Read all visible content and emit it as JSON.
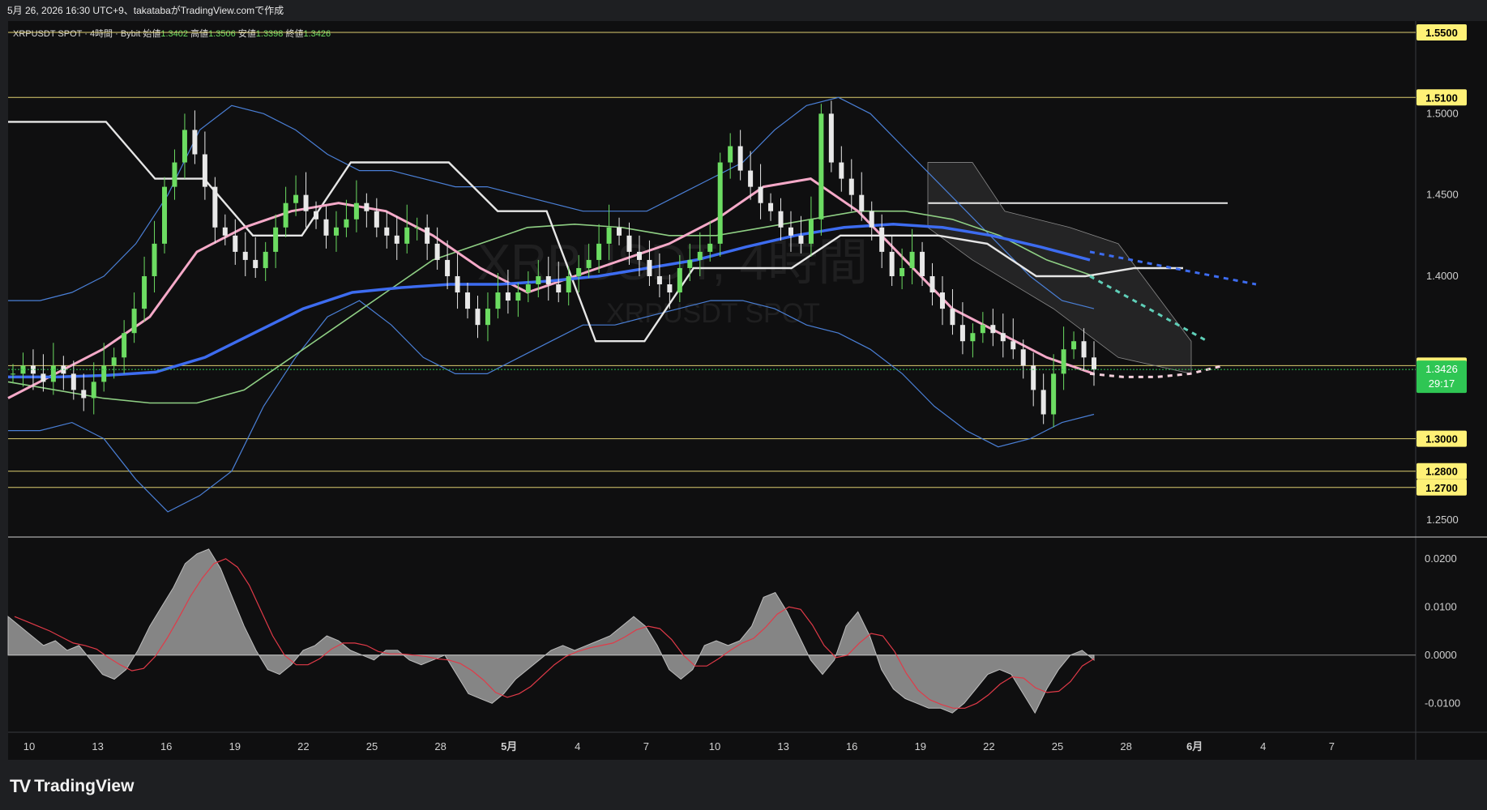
{
  "header": {
    "created_line": "5月 26, 2026 16:30 UTC+9、takatabaがTradingView.comで作成"
  },
  "legend": {
    "symbol_line": "XRPUSDT SPOT · 4時間 · Bybit",
    "open_label": "始値",
    "open_value": "1.3402",
    "high_label": "高値",
    "high_value": "1.3506",
    "low_label": "安値",
    "low_value": "1.3398",
    "close_label": "終値",
    "close_value": "1.3426"
  },
  "watermark": {
    "line1": "XRPUSDT, 4時間",
    "line2": "XRPUSDT SPOT"
  },
  "footer": {
    "brand": "TradingView"
  },
  "countdown": "29:17",
  "colors": {
    "background": "#0f0f10",
    "panel": "#1e1f22",
    "up_candle": "#6cdc62",
    "down_candle": "#e8e8e8",
    "level_line": "#f4e27a",
    "level_label_bg": "#fff176",
    "price_label_bg": "#2fc654",
    "ema_long": "#3d6cf0",
    "ema_mid": "#f5a9c8",
    "sma_green": "#8fcf84",
    "bollinger": "#4a7fd6",
    "ichimoku": "#e6e6e6",
    "oscillator_fill": "#9a9a9a",
    "signal_line": "#e03a48"
  },
  "chart_data": [
    {
      "type": "candlestick",
      "symbol": "XRPUSDT SPOT",
      "timeframe": "4時間",
      "exchange": "Bybit",
      "ylim": [
        1.24,
        1.555
      ],
      "y_ticks": [
        "1.5000",
        "1.4500",
        "1.4000",
        "1.2500"
      ],
      "x_ticks": [
        "10",
        "13",
        "16",
        "19",
        "22",
        "25",
        "28",
        "5月",
        "4",
        "7",
        "10",
        "13",
        "16",
        "19",
        "22",
        "25",
        "28",
        "6月",
        "4",
        "7"
      ],
      "horizontal_levels": [
        "1.5500",
        "1.5100",
        "1.3450",
        "1.3000",
        "1.2800",
        "1.2700"
      ],
      "current_price": "1.3426",
      "ohlc_last": {
        "open": 1.3402,
        "high": 1.3506,
        "low": 1.3398,
        "close": 1.3426
      },
      "series": [
        {
          "kind": "close_path",
          "values": [
            1.34,
            1.345,
            1.34,
            1.335,
            1.345,
            1.34,
            1.33,
            1.325,
            1.335,
            1.345,
            1.35,
            1.365,
            1.38,
            1.4,
            1.42,
            1.455,
            1.47,
            1.49,
            1.475,
            1.455,
            1.43,
            1.425,
            1.415,
            1.41,
            1.405,
            1.415,
            1.43,
            1.445,
            1.45,
            1.44,
            1.435,
            1.425,
            1.43,
            1.435,
            1.445,
            1.44,
            1.43,
            1.425,
            1.42,
            1.43,
            1.43,
            1.42,
            1.41,
            1.4,
            1.39,
            1.38,
            1.37,
            1.38,
            1.39,
            1.385,
            1.39,
            1.395,
            1.4,
            1.395,
            1.39,
            1.4,
            1.405,
            1.41,
            1.42,
            1.43,
            1.425,
            1.415,
            1.41,
            1.4,
            1.395,
            1.39,
            1.405,
            1.41,
            1.415,
            1.42,
            1.47,
            1.48,
            1.465,
            1.455,
            1.445,
            1.44,
            1.43,
            1.425,
            1.42,
            1.435,
            1.5,
            1.47,
            1.46,
            1.45,
            1.44,
            1.43,
            1.415,
            1.4,
            1.405,
            1.415,
            1.4,
            1.39,
            1.38,
            1.37,
            1.36,
            1.365,
            1.37,
            1.365,
            1.36,
            1.355,
            1.345,
            1.33,
            1.315,
            1.34,
            1.355,
            1.36,
            1.35,
            1.3426
          ]
        },
        {
          "kind": "bollinger_upper",
          "values": [
            1.385,
            1.385,
            1.39,
            1.4,
            1.42,
            1.45,
            1.49,
            1.505,
            1.5,
            1.49,
            1.475,
            1.465,
            1.465,
            1.46,
            1.455,
            1.455,
            1.45,
            1.445,
            1.44,
            1.44,
            1.44,
            1.45,
            1.46,
            1.47,
            1.49,
            1.505,
            1.51,
            1.5,
            1.48,
            1.46,
            1.44,
            1.42,
            1.4,
            1.385,
            1.38
          ]
        },
        {
          "kind": "bollinger_lower",
          "values": [
            1.305,
            1.305,
            1.31,
            1.3,
            1.275,
            1.255,
            1.265,
            1.28,
            1.32,
            1.35,
            1.375,
            1.385,
            1.37,
            1.35,
            1.34,
            1.34,
            1.35,
            1.36,
            1.37,
            1.37,
            1.375,
            1.38,
            1.385,
            1.385,
            1.38,
            1.37,
            1.365,
            1.355,
            1.34,
            1.32,
            1.305,
            1.295,
            1.3,
            1.31,
            1.315
          ]
        },
        {
          "kind": "ema_long",
          "values": [
            1.338,
            1.338,
            1.339,
            1.341,
            1.35,
            1.365,
            1.38,
            1.39,
            1.393,
            1.395,
            1.395,
            1.397,
            1.4,
            1.405,
            1.41,
            1.418,
            1.425,
            1.43,
            1.432,
            1.43,
            1.425,
            1.418,
            1.41
          ]
        },
        {
          "kind": "ema_mid",
          "values": [
            1.325,
            1.34,
            1.355,
            1.375,
            1.415,
            1.43,
            1.44,
            1.445,
            1.44,
            1.425,
            1.405,
            1.39,
            1.4,
            1.41,
            1.42,
            1.435,
            1.455,
            1.46,
            1.44,
            1.41,
            1.38,
            1.365,
            1.35,
            1.34
          ]
        },
        {
          "kind": "sma_green",
          "values": [
            1.335,
            1.33,
            1.325,
            1.322,
            1.322,
            1.33,
            1.35,
            1.37,
            1.39,
            1.41,
            1.42,
            1.43,
            1.432,
            1.43,
            1.425,
            1.425,
            1.43,
            1.435,
            1.44,
            1.44,
            1.435,
            1.425,
            1.41,
            1.4
          ]
        },
        {
          "kind": "ichimoku_base",
          "values": [
            1.495,
            1.495,
            1.495,
            1.46,
            1.46,
            1.425,
            1.425,
            1.47,
            1.47,
            1.47,
            1.44,
            1.44,
            1.36,
            1.36,
            1.405,
            1.405,
            1.405,
            1.425,
            1.425,
            1.425,
            1.42,
            1.4,
            1.4,
            1.405,
            1.405
          ]
        },
        {
          "kind": "ichimoku_senkou_top",
          "values": [
            1.445,
            1.445,
            1.445,
            1.445,
            1.445
          ]
        },
        {
          "kind": "projection_blue",
          "values": [
            1.415,
            1.41,
            1.405,
            1.4,
            1.395
          ]
        },
        {
          "kind": "projection_teal",
          "values": [
            1.4,
            1.39,
            1.38,
            1.37,
            1.36
          ]
        },
        {
          "kind": "projection_pink",
          "values": [
            1.34,
            1.338,
            1.338,
            1.34,
            1.345
          ]
        }
      ]
    },
    {
      "type": "area",
      "name": "oscillator",
      "ylim": [
        -0.016,
        0.024
      ],
      "y_ticks": [
        "0.0200",
        "0.0100",
        "0.0000",
        "-0.0100"
      ],
      "values": [
        0.008,
        0.006,
        0.004,
        0.002,
        0.003,
        0.001,
        0.002,
        -0.001,
        -0.004,
        -0.005,
        -0.003,
        0.001,
        0.006,
        0.01,
        0.014,
        0.019,
        0.021,
        0.022,
        0.018,
        0.012,
        0.006,
        0.001,
        -0.003,
        -0.004,
        -0.002,
        0.001,
        0.002,
        0.004,
        0.003,
        0.001,
        0.0,
        -0.001,
        0.001,
        0.001,
        -0.001,
        -0.002,
        -0.001,
        0.0,
        -0.004,
        -0.008,
        -0.009,
        -0.01,
        -0.008,
        -0.005,
        -0.003,
        -0.001,
        0.001,
        0.002,
        0.001,
        0.002,
        0.003,
        0.004,
        0.006,
        0.008,
        0.006,
        0.002,
        -0.003,
        -0.005,
        -0.003,
        0.002,
        0.003,
        0.002,
        0.003,
        0.006,
        0.012,
        0.013,
        0.009,
        0.004,
        -0.001,
        -0.004,
        -0.001,
        0.006,
        0.009,
        0.004,
        -0.003,
        -0.007,
        -0.009,
        -0.01,
        -0.011,
        -0.011,
        -0.012,
        -0.01,
        -0.007,
        -0.004,
        -0.003,
        -0.004,
        -0.008,
        -0.012,
        -0.007,
        -0.003,
        0.0,
        0.001,
        -0.001
      ]
    }
  ]
}
